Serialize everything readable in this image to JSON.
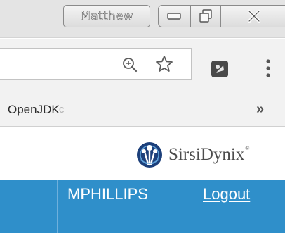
{
  "titlebar": {
    "profile_name": "Matthew"
  },
  "toolbar": {
    "icons": [
      "zoom-icon",
      "bookmark-star-icon",
      "extension-icon",
      "menu-icon"
    ]
  },
  "bookmarks": {
    "item_label": "OpenJDK",
    "item_ellipsis": "c",
    "overflow": "»"
  },
  "header": {
    "brand_name": "SirsiDynix",
    "trademark": "®",
    "username": "MPHILLIPS",
    "logout_label": "Logout"
  },
  "colors": {
    "brand_blue": "#2f8fca",
    "logo_navy": "#1c3f7a",
    "chrome_gray": "#f2f2f2"
  }
}
